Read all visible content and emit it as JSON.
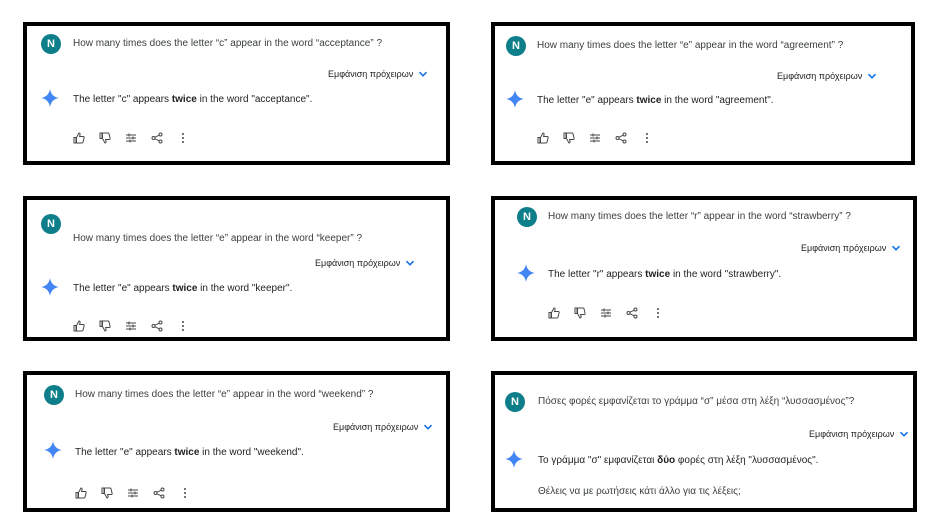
{
  "avatar_letter": "N",
  "drafts_label": "Εμφάνιση πρόχειρων",
  "icons": {
    "avatar": "user-avatar",
    "spark": "gemini-sparkle-icon",
    "chevron": "chevron-down-icon",
    "actions": [
      "thumbs-up-icon",
      "thumbs-down-icon",
      "modify-response-icon",
      "share-icon",
      "more-options-icon"
    ]
  },
  "colors": {
    "avatar_bg": "#0e7f8a",
    "accent": "#1a73e8",
    "sparkle": "#4285f4"
  },
  "panels": [
    {
      "question": "How many times does the letter “c” appear in the word “acceptance” ?",
      "answer_before": "The letter \"c\" appears ",
      "answer_bold": "twice",
      "answer_after": " in the word \"acceptance\"."
    },
    {
      "question": "How many times does the letter “e” appear in the word “agreement” ?",
      "answer_before": "The letter \"e\" appears ",
      "answer_bold": "twice",
      "answer_after": " in the word \"agreement\"."
    },
    {
      "question": "How many times does the letter “e” appear in the word “keeper” ?",
      "answer_before": "The letter \"e\" appears ",
      "answer_bold": "twice",
      "answer_after": " in the word \"keeper\"."
    },
    {
      "question": "How many times does the letter “r” appear in the word “strawberry” ?",
      "answer_before": "The letter \"r\" appears ",
      "answer_bold": "twice",
      "answer_after": " in the word \"strawberry\"."
    },
    {
      "question": "How many times does the letter “e” appear in the word “weekend” ?",
      "answer_before": "The letter \"e\" appears ",
      "answer_bold": "twice",
      "answer_after": " in the word \"weekend\"."
    },
    {
      "question": "Πόσες φορές εμφανίζεται το γράμμα “σ” μέσα στη λέξη “λυσσασμένος”?",
      "answer_before": "Το γράμμα \"σ\" εμφανίζεται ",
      "answer_bold": "δύο",
      "answer_after": " φορές στη λέξη \"λυσσασμένος\".",
      "followup": "Θέλεις να με ρωτήσεις κάτι άλλο για τις λέξεις;"
    }
  ]
}
